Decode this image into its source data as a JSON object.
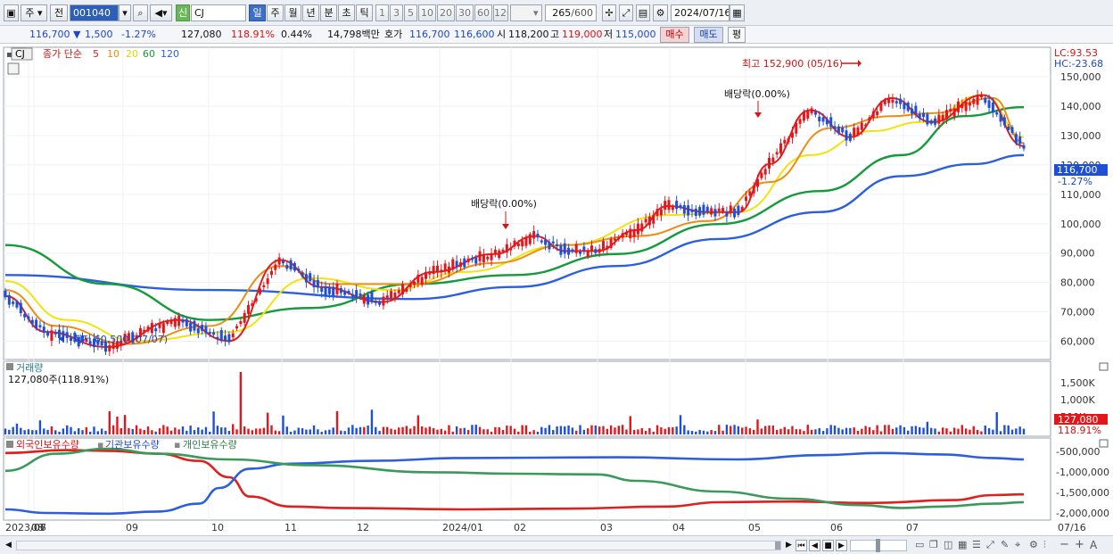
{
  "toolbar": {
    "type_select": "주",
    "prev_label": "전",
    "code": "001040",
    "stock_name": "CJ",
    "badge": "신",
    "periods": [
      "일",
      "주",
      "월",
      "년",
      "분",
      "초",
      "틱"
    ],
    "active_period": "일",
    "ticks": [
      "1",
      "3",
      "5",
      "10",
      "20",
      "30",
      "60",
      "120"
    ],
    "count": "265",
    "count_total": "/600",
    "date": "2024/07/16"
  },
  "infobar": {
    "price": "116,700",
    "change": "1,500",
    "change_pct": "-1.27%",
    "volume": "127,080",
    "volume_pct": "118.91%",
    "turnover": "0.44%",
    "amount": "14,798백만",
    "quote_label": "호가",
    "ask": "116,700",
    "bid": "116,600",
    "open_label": "시",
    "open": "118,200",
    "high_label": "고",
    "high": "119,000",
    "low_label": "저",
    "low": "115,000",
    "buy_button": "매수",
    "sell_button": "매도",
    "eval_button": "평"
  },
  "colors": {
    "up": "#e4161b",
    "down": "#1f4fd6",
    "ma5": "#e01f1f",
    "ma10": "#ef8c10",
    "ma20": "#f2e30e",
    "ma60": "#159a3c",
    "ma120": "#2b5fe0",
    "foreign": "#e01f1f",
    "institution": "#2b5fe0",
    "individual": "#3a9a5a"
  },
  "chart_data": [
    {
      "type": "candlestick",
      "panel": "price",
      "legend_prefix": "CJ",
      "legend_label": "종가 단순",
      "legend_periods": [
        "5",
        "10",
        "20",
        "60",
        "120"
      ],
      "lc_label": "LC:93.53",
      "hc_label": "HC:-23.68",
      "ylim": [
        55000,
        157000
      ],
      "y_ticks": [
        "60,000",
        "70,000",
        "80,000",
        "90,000",
        "100,000",
        "110,000",
        "120,000",
        "130,000",
        "140,000",
        "150,000"
      ],
      "current_price_label": "116,700",
      "current_change_label": "-1.27%",
      "annotations": [
        {
          "text": "최고 152,900 (05/16)",
          "x": "2024-05-16",
          "y": 152900
        },
        {
          "text": "최저 60,500 (07/07)",
          "x": "2023-07-07",
          "y": 60500
        },
        {
          "text": "배당락(0.00%)",
          "x": "2023-12-27",
          "y": 99000
        },
        {
          "text": "배당락(0.00%)",
          "x": "2024-03-28",
          "y": 135000
        }
      ],
      "monthly_close": [
        {
          "x": "2023-06",
          "y": 79000
        },
        {
          "x": "2023-07",
          "y": 62000
        },
        {
          "x": "2023-08",
          "y": 74000
        },
        {
          "x": "2023-09",
          "y": 70000
        },
        {
          "x": "2023-10",
          "y": 88000
        },
        {
          "x": "2023-11",
          "y": 78000
        },
        {
          "x": "2023-12",
          "y": 89000
        },
        {
          "x": "2024-01",
          "y": 98000
        },
        {
          "x": "2024-02",
          "y": 88000
        },
        {
          "x": "2024-03",
          "y": 103000
        },
        {
          "x": "2024-04",
          "y": 122000
        },
        {
          "x": "2024-05",
          "y": 142000
        },
        {
          "x": "2024-06",
          "y": 124000
        },
        {
          "x": "2024-07",
          "y": 116700
        }
      ],
      "ma_anchors": [
        {
          "name": "5",
          "values": [
            [
              0,
              0.8
            ],
            [
              0.04,
              0.92
            ],
            [
              0.1,
              0.97
            ],
            [
              0.17,
              0.88
            ],
            [
              0.22,
              0.95
            ],
            [
              0.27,
              0.68
            ],
            [
              0.31,
              0.77
            ],
            [
              0.37,
              0.82
            ],
            [
              0.42,
              0.72
            ],
            [
              0.48,
              0.66
            ],
            [
              0.52,
              0.6
            ],
            [
              0.55,
              0.65
            ],
            [
              0.58,
              0.65
            ],
            [
              0.62,
              0.58
            ],
            [
              0.65,
              0.5
            ],
            [
              0.69,
              0.52
            ],
            [
              0.72,
              0.52
            ],
            [
              0.75,
              0.36
            ],
            [
              0.79,
              0.18
            ],
            [
              0.83,
              0.27
            ],
            [
              0.87,
              0.14
            ],
            [
              0.91,
              0.22
            ],
            [
              0.96,
              0.13
            ],
            [
              1,
              0.3
            ]
          ]
        },
        {
          "name": "10",
          "values": [
            [
              0,
              0.78
            ],
            [
              0.05,
              0.9
            ],
            [
              0.12,
              0.96
            ],
            [
              0.2,
              0.9
            ],
            [
              0.27,
              0.7
            ],
            [
              0.32,
              0.76
            ],
            [
              0.4,
              0.76
            ],
            [
              0.48,
              0.69
            ],
            [
              0.55,
              0.63
            ],
            [
              0.62,
              0.6
            ],
            [
              0.69,
              0.55
            ],
            [
              0.75,
              0.42
            ],
            [
              0.81,
              0.24
            ],
            [
              0.87,
              0.2
            ],
            [
              0.91,
              0.19
            ],
            [
              0.97,
              0.14
            ],
            [
              1,
              0.29
            ]
          ]
        },
        {
          "name": "20",
          "values": [
            [
              0,
              0.75
            ],
            [
              0.06,
              0.88
            ],
            [
              0.13,
              0.95
            ],
            [
              0.22,
              0.92
            ],
            [
              0.3,
              0.74
            ],
            [
              0.38,
              0.78
            ],
            [
              0.45,
              0.72
            ],
            [
              0.55,
              0.63
            ],
            [
              0.65,
              0.53
            ],
            [
              0.72,
              0.52
            ],
            [
              0.79,
              0.33
            ],
            [
              0.85,
              0.25
            ],
            [
              0.9,
              0.22
            ],
            [
              0.96,
              0.13
            ],
            [
              1,
              0.27
            ]
          ]
        },
        {
          "name": "60",
          "values": [
            [
              0,
              0.63
            ],
            [
              0.1,
              0.76
            ],
            [
              0.2,
              0.88
            ],
            [
              0.3,
              0.84
            ],
            [
              0.4,
              0.76
            ],
            [
              0.5,
              0.73
            ],
            [
              0.6,
              0.66
            ],
            [
              0.7,
              0.56
            ],
            [
              0.8,
              0.45
            ],
            [
              0.88,
              0.33
            ],
            [
              0.94,
              0.2
            ],
            [
              1,
              0.17
            ]
          ]
        },
        {
          "name": "120",
          "values": [
            [
              0,
              0.73
            ],
            [
              0.2,
              0.78
            ],
            [
              0.4,
              0.81
            ],
            [
              0.5,
              0.77
            ],
            [
              0.6,
              0.7
            ],
            [
              0.7,
              0.61
            ],
            [
              0.8,
              0.52
            ],
            [
              0.88,
              0.4
            ],
            [
              0.95,
              0.36
            ],
            [
              1,
              0.33
            ]
          ]
        }
      ]
    },
    {
      "type": "bar",
      "panel": "volume",
      "title": "거래량",
      "subtitle": "127,080주(118.91%)",
      "y_ticks": [
        "500K",
        "1,000K",
        "1,500K"
      ],
      "current_volume_label": "127,080",
      "current_pct_label": "118.91%"
    },
    {
      "type": "line",
      "panel": "holdings",
      "series": [
        {
          "name": "외국인보유수량"
        },
        {
          "name": "기관보유수량"
        },
        {
          "name": "개인보유수량"
        }
      ],
      "y_ticks": [
        "-500,000",
        "-1,000,000",
        "-1,500,000",
        "-2,000,000"
      ]
    }
  ],
  "x_axis": {
    "labels": [
      "2023/06",
      "07",
      "08",
      "09",
      "10",
      "11",
      "12",
      "2024/01",
      "02",
      "03",
      "04",
      "05",
      "06",
      "07"
    ],
    "right_label": "07/16"
  },
  "bottombar": {
    "zoom_out": "−",
    "zoom_in": "+",
    "font_label": "A"
  }
}
